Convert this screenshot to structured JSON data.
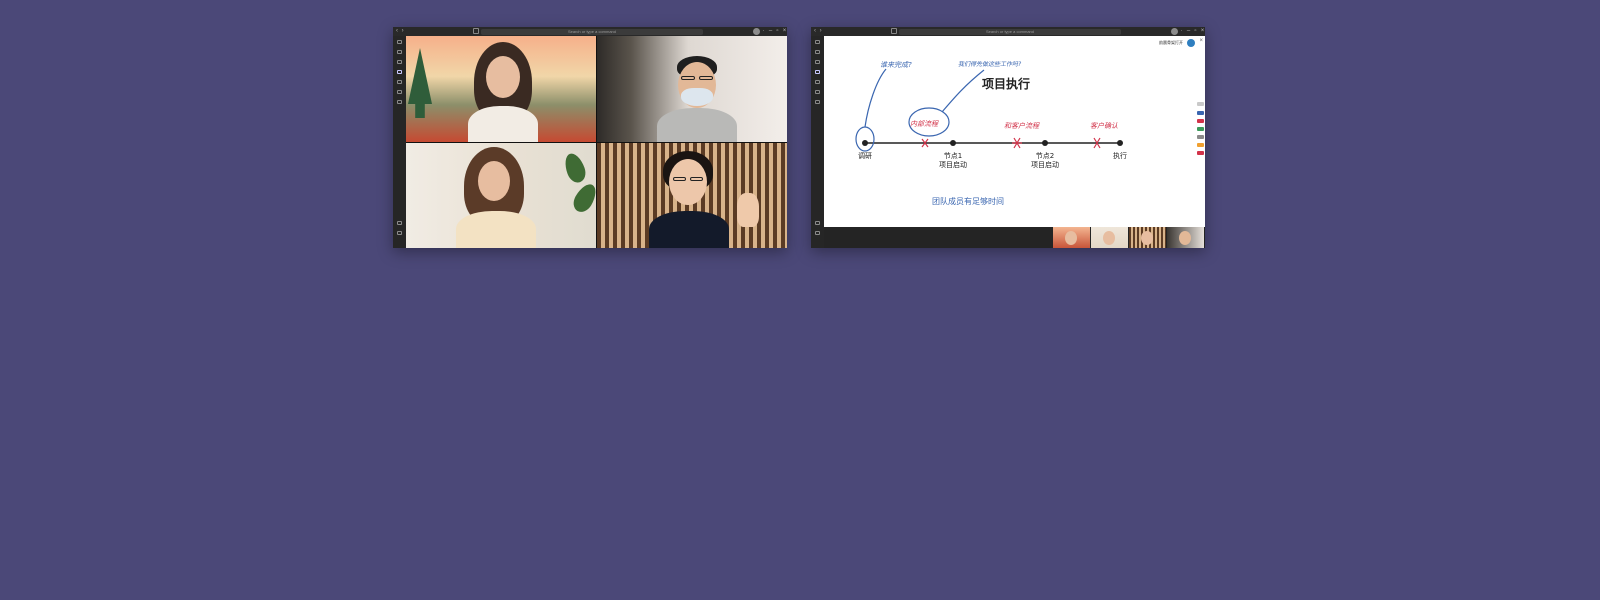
{
  "windows": [
    {
      "search": {
        "placeholder": "Search or type a command"
      },
      "view": "gallery"
    },
    {
      "search": {
        "placeholder": "Search or type a command"
      },
      "view": "whiteboard"
    }
  ],
  "whiteboard": {
    "owner_name": "韵晨骨架打开",
    "title": "项目执行",
    "timeline": {
      "nodes": [
        {
          "label": "调研",
          "sublabel": ""
        },
        {
          "label": "节点1",
          "sublabel": "项目启动"
        },
        {
          "label": "节点2",
          "sublabel": "项目启动"
        },
        {
          "label": "执行",
          "sublabel": ""
        }
      ]
    },
    "annotations": {
      "circle_note": "内部流程",
      "note_question": "谁来完成?",
      "note_comment": "我们得先做这些工作吗?",
      "note_client_flow": "和客户流程",
      "note_client_confirm": "客户确认",
      "bottom_note": "团队成员有足够时间"
    },
    "ink_colors": {
      "blue": "#3a66b0",
      "red": "#d2334a"
    }
  },
  "icons": {
    "title_nav": "back-forward-icon",
    "title_edit": "compose-icon",
    "window_controls": [
      "more-icon",
      "minimize-icon",
      "maximize-icon",
      "close-icon"
    ]
  }
}
